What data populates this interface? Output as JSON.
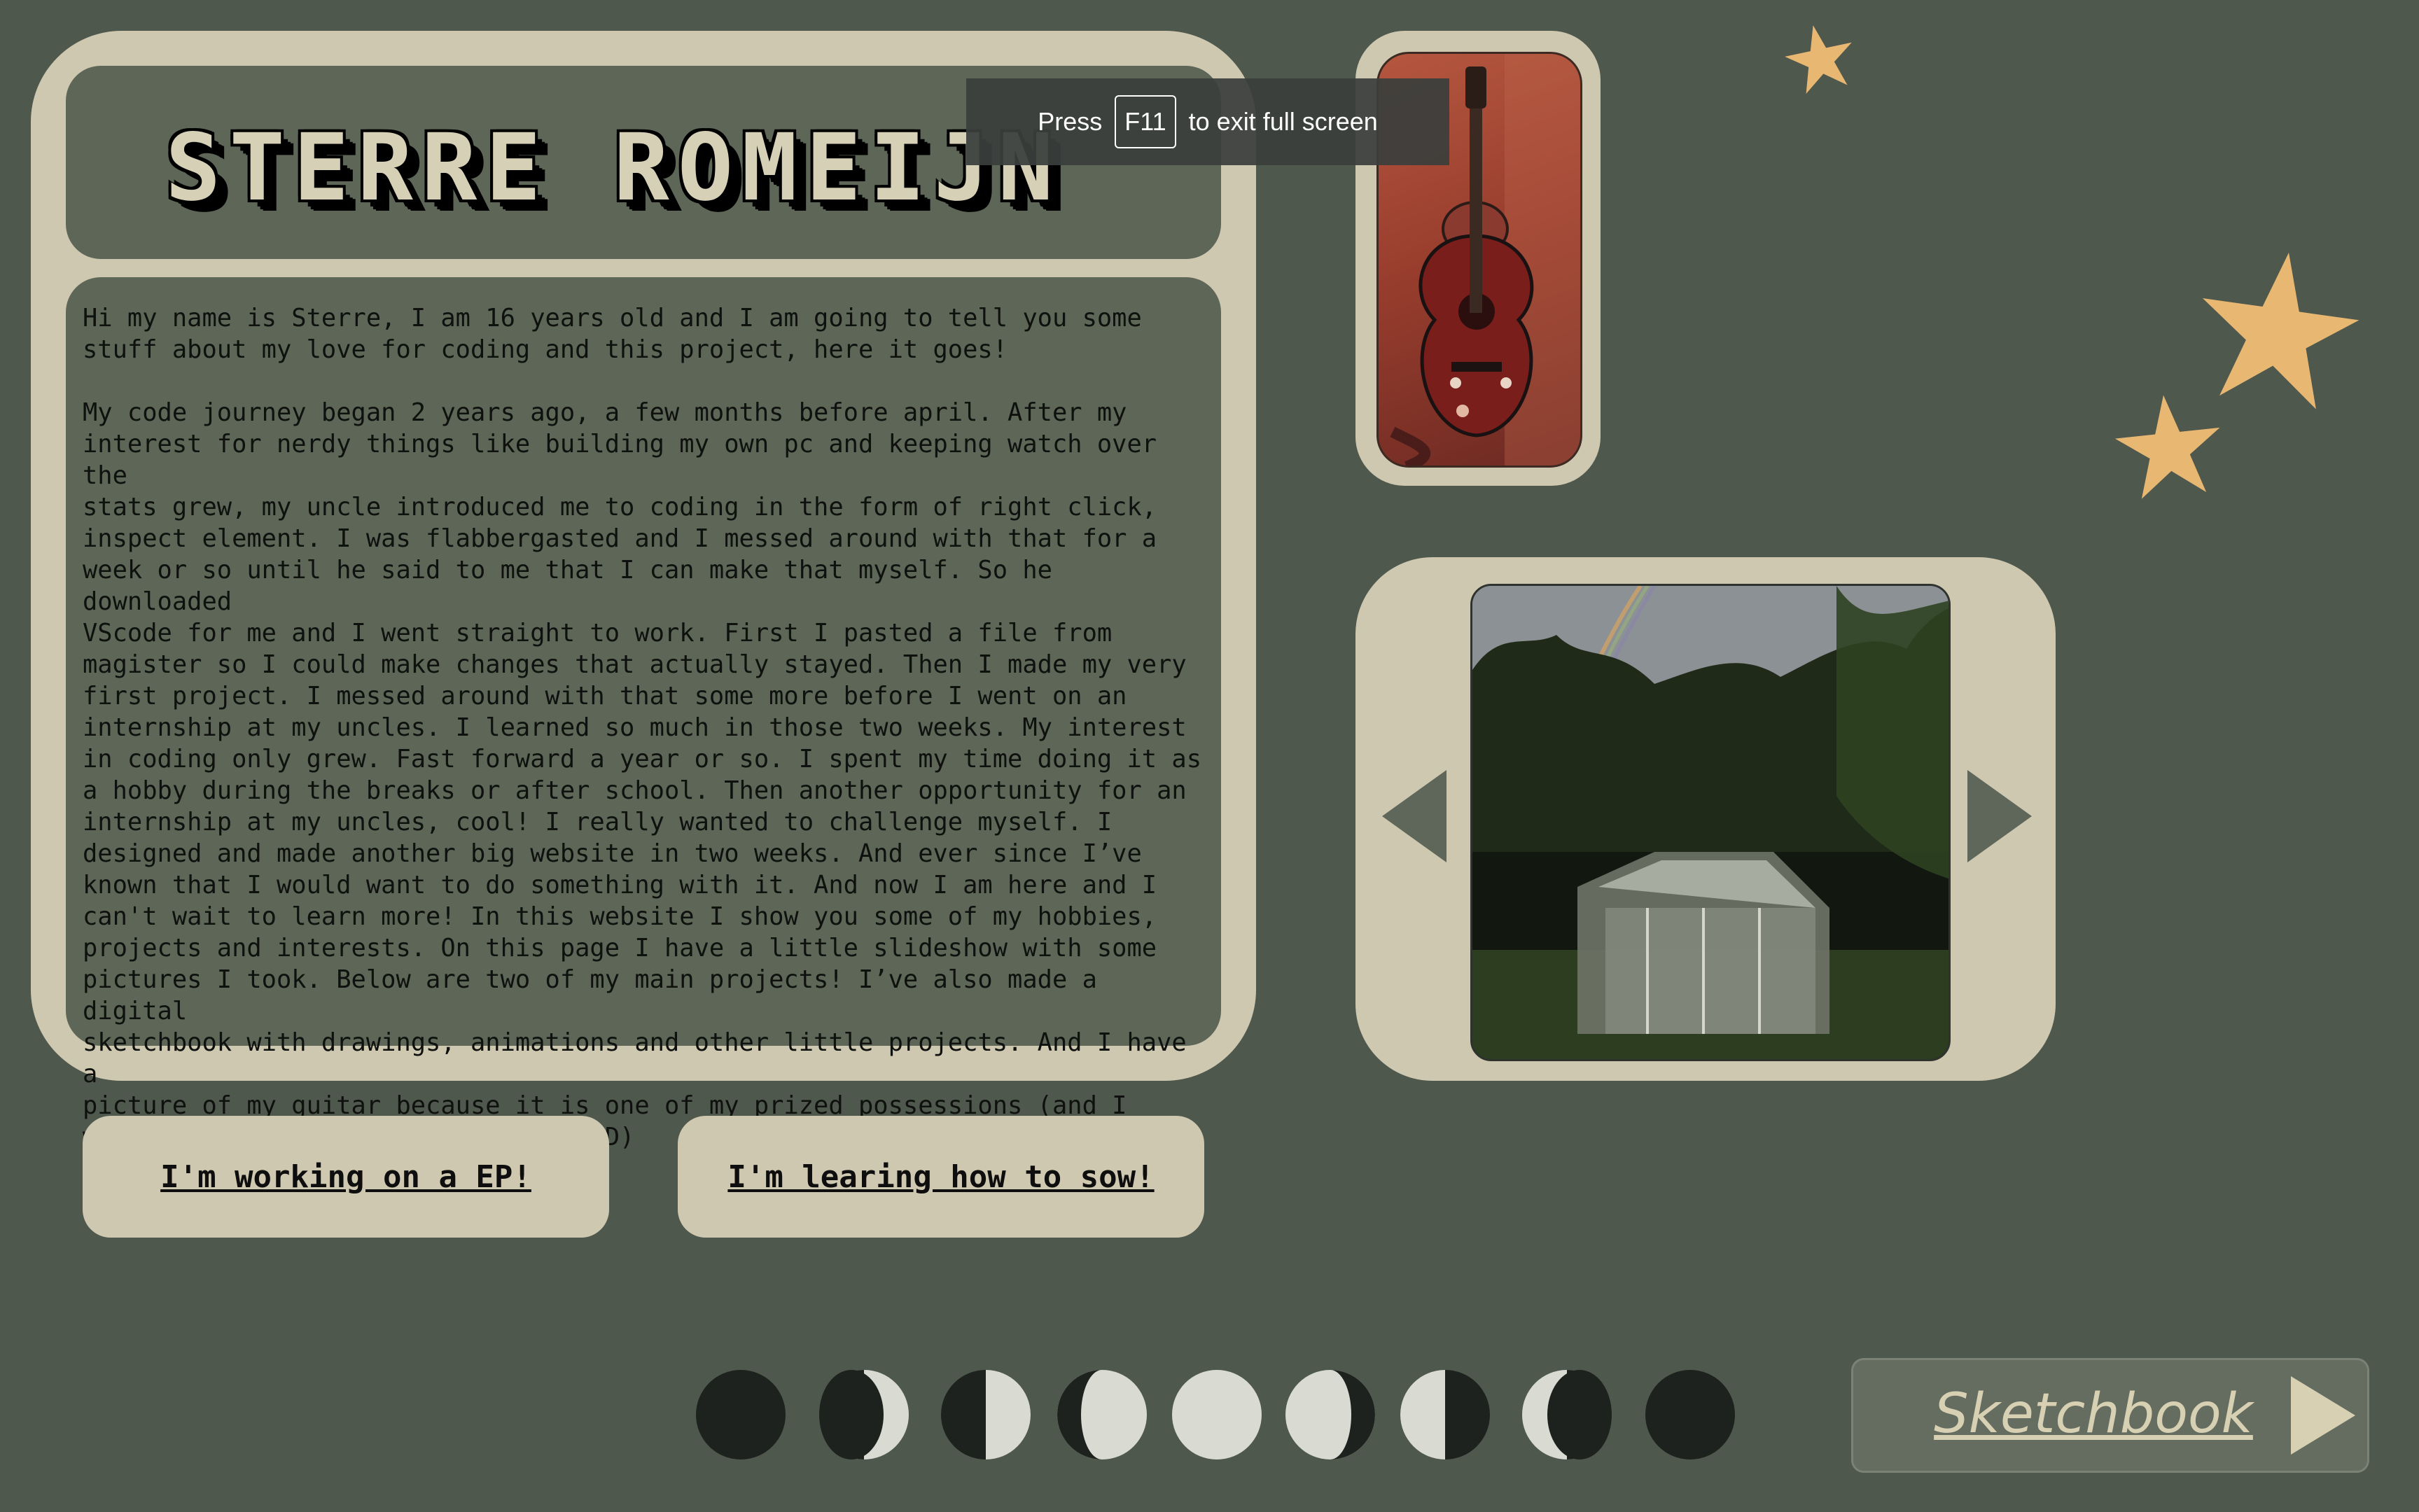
{
  "header": {
    "title": "STERRE ROMEIJN"
  },
  "fullscreen_hint": {
    "prefix": "Press",
    "key": "F11",
    "suffix": "to exit full screen"
  },
  "intro": {
    "text": "Hi my name is Sterre, I am 16 years old and I am going to tell you some\nstuff about my love for coding and this project, here it goes!\n\nMy code journey began 2 years ago, a few months before april. After my\ninterest for nerdy things like building my own pc and keeping watch over the\nstats grew, my uncle introduced me to coding in the form of right click,\ninspect element. I was flabbergasted and I messed around with that for a\nweek or so until he said to me that I can make that myself. So he downloaded\nVScode for me and I went straight to work. First I pasted a file from\nmagister so I could make changes that actually stayed. Then I made my very\nfirst project. I messed around with that some more before I went on an\ninternship at my uncles. I learned so much in those two weeks. My interest\nin coding only grew. Fast forward a year or so. I spent my time doing it as\na hobby during the breaks or after school. Then another opportunity for an\ninternship at my uncles, cool! I really wanted to challenge myself. I\ndesigned and made another big website in two weeks. And ever since I’ve\nknown that I would want to do something with it. And now I am here and I\ncan't wait to learn more! In this website I show you some of my hobbies,\nprojects and interests. On this page I have a little slideshow with some\npictures I took. Below are two of my main projects! I’ve also made a digital\nsketchbook with drawings, animations and other little projects. And I have a\npicture of my guitar because it is one of my prized possessions (and I\nwanted to show off how cool it is :D)"
  },
  "projects": {
    "ep_label": "I'm working on a EP!",
    "sow_label": "I'm learing how to sow!"
  },
  "sketchbook": {
    "label": "Sketchbook"
  },
  "moon_phases": [
    "new",
    "waxing-crescent",
    "first-quarter",
    "waxing-gibbous",
    "full",
    "waning-gibbous",
    "last-quarter",
    "waning-crescent",
    "new"
  ],
  "colors": {
    "background": "#4f584d",
    "card": "#cfc8b0",
    "panel": "#5d6657",
    "star": "#e8b772",
    "moon_dark": "#1e221e",
    "moon_light": "#d9dbd2"
  }
}
